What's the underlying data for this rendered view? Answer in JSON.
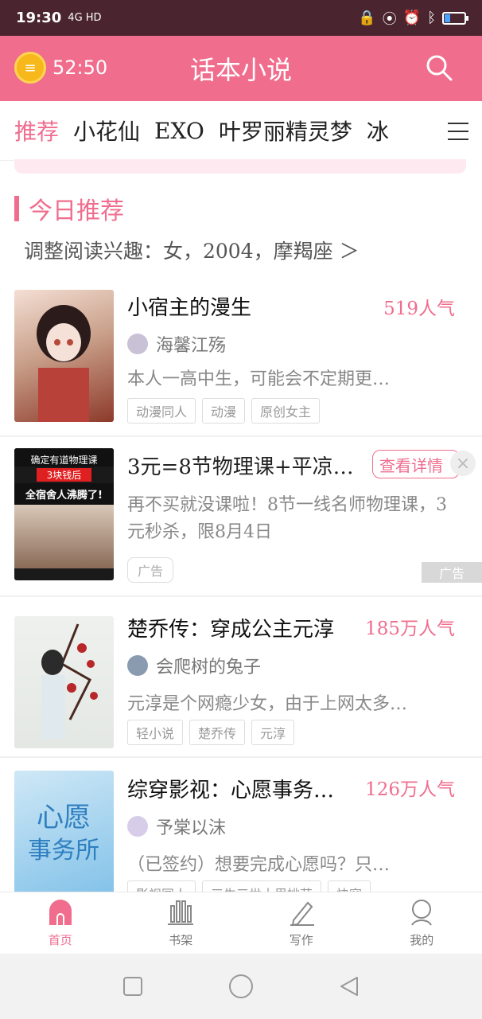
{
  "status_bar": {
    "time": "19:30",
    "signal": "4G HD",
    "colors": {
      "bg": "#4a2530"
    }
  },
  "header": {
    "timer": "52:50",
    "title": "话本小说",
    "accent": "#f06d8e"
  },
  "tabs": [
    "推荐",
    "小花仙",
    "EXO",
    "叶罗丽精灵梦",
    "冰"
  ],
  "section": {
    "title": "今日推荐",
    "interest": "调整阅读兴趣：女，2004，摩羯座 ＞"
  },
  "books": [
    {
      "name": "小宿主的漫生",
      "popularity": "519人气",
      "author": "海馨江殇",
      "desc": "本人一高中生，可能会不定期更…",
      "tags": [
        "动漫同人",
        "动漫",
        "原创女主"
      ]
    },
    {
      "name": "楚乔传：穿成公主元淳",
      "popularity": "185万人气",
      "author": "会爬树的兔子",
      "desc": "元淳是个网瘾少女，由于上网太多…",
      "tags": [
        "轻小说",
        "楚乔传",
        "元淳"
      ]
    },
    {
      "name": "综穿影视：心愿事务…",
      "popularity": "126万人气",
      "author": "予棠以沫",
      "desc": "（已签约）想要完成心愿吗？只…",
      "tags": [
        "影视同人",
        "三生三世十里桃花",
        "快穿"
      ]
    }
  ],
  "ad": {
    "title": "3元=8节物理课+平凉…",
    "button": "查看详情",
    "desc": "再不买就没课啦！8节一线名师物理课，3元秒杀，限8月4日",
    "label": "广告",
    "mark": "广告",
    "cover_lines": [
      "确定有道物理课",
      "3块钱后",
      "全宿舍人沸腾了!"
    ]
  },
  "bottom_nav": [
    {
      "label": "首页",
      "icon": "home-icon"
    },
    {
      "label": "书架",
      "icon": "bookshelf-icon"
    },
    {
      "label": "写作",
      "icon": "pen-icon"
    },
    {
      "label": "我的",
      "icon": "profile-icon"
    }
  ]
}
